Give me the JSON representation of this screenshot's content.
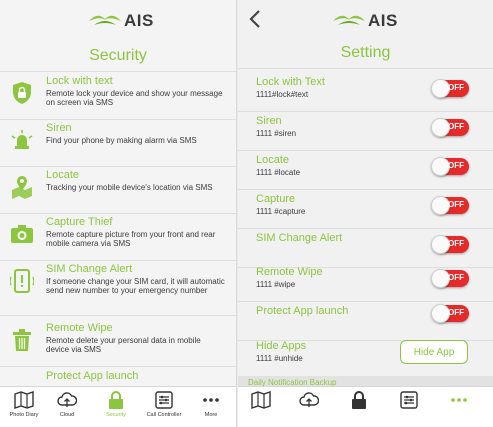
{
  "brand": {
    "logo_text": "AIS",
    "green": "#8cc63f",
    "red": "#e52a2a"
  },
  "left": {
    "title": "Security",
    "items": [
      {
        "icon": "lock-icon",
        "title": "Lock with text",
        "desc": "Remote lock your device and show your message on screen via SMS"
      },
      {
        "icon": "siren-icon",
        "title": "Siren",
        "desc": "Find your phone by making alarm via SMS"
      },
      {
        "icon": "map-pin-icon",
        "title": "Locate",
        "desc": "Tracking your mobile device's location via SMS"
      },
      {
        "icon": "camera-icon",
        "title": "Capture Thief",
        "desc": "Remote capture picture from your front and rear mobile camera via SMS"
      },
      {
        "icon": "sim-alert-icon",
        "title": "SIM Change Alert",
        "desc": "If someone change your SIM card, it will automatic send new number to your emergency number"
      },
      {
        "icon": "trash-icon",
        "title": "Remote Wipe",
        "desc": "Remote delete your personal data in mobile device via SMS"
      },
      {
        "icon": "",
        "title": "Protect App launch",
        "desc": ""
      }
    ],
    "nav": [
      {
        "icon": "photo-diary-icon",
        "label": "Photo Diary"
      },
      {
        "icon": "cloud-icon",
        "label": "Cloud"
      },
      {
        "icon": "security-lock-icon",
        "label": "Security"
      },
      {
        "icon": "call-controller-icon",
        "label": "Call Controller"
      },
      {
        "icon": "more-icon",
        "label": "More"
      }
    ]
  },
  "right": {
    "title": "Setting",
    "items": [
      {
        "title": "Lock with Text",
        "code": "1111#lock#text",
        "toggle": "OFF"
      },
      {
        "title": "Siren",
        "code": "1111 #siren",
        "toggle": "OFF"
      },
      {
        "title": "Locate",
        "code": "1111 #locate",
        "toggle": "OFF"
      },
      {
        "title": "Capture",
        "code": "1111 #capture",
        "toggle": "OFF"
      },
      {
        "title": "SIM Change Alert",
        "code": "",
        "toggle": "OFF"
      },
      {
        "title": "Remote Wipe",
        "code": "1111 #wipe",
        "toggle": "OFF"
      },
      {
        "title": "Protect App launch",
        "code": "",
        "toggle": "OFF"
      }
    ],
    "hide_apps": {
      "title": "Hide Apps",
      "code": "1111 #unhide",
      "button": "Hide App"
    },
    "daily_header": "Daily Notification Backup"
  }
}
